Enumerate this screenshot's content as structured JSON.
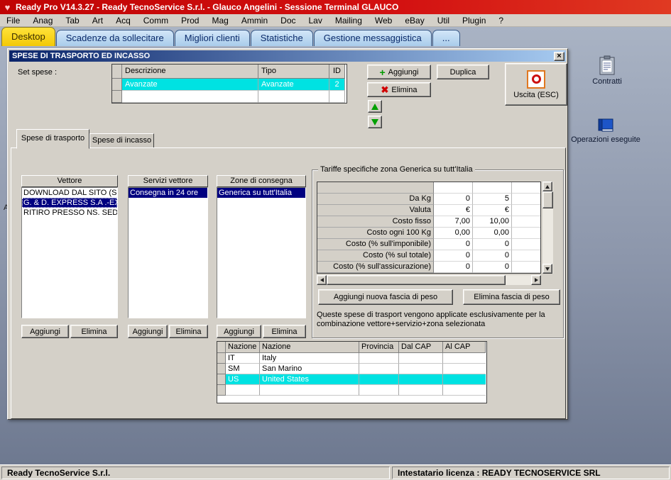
{
  "window": {
    "title": "Ready Pro V14.3.27 - Ready TecnoService S.r.l. - Glauco Angelini - Sessione Terminal GLAUCO"
  },
  "menu": {
    "items": [
      "File",
      "Anag",
      "Tab",
      "Art",
      "Acq",
      "Comm",
      "Prod",
      "Mag",
      "Ammin",
      "Doc",
      "Lav",
      "Mailing",
      "Web",
      "eBay",
      "Util",
      "Plugin",
      "?"
    ]
  },
  "main_tabs": [
    {
      "label": "Desktop"
    },
    {
      "label": "Scadenze da sollecitare"
    },
    {
      "label": "Migliori clienti"
    },
    {
      "label": "Statistiche"
    },
    {
      "label": "Gestione messaggistica"
    },
    {
      "label": "..."
    }
  ],
  "dialog": {
    "title": "SPESE DI TRASPORTO ED INCASSO",
    "close_glyph": "×",
    "set_spese_label": "Set spese :",
    "set_grid": {
      "headers": [
        "Descrizione",
        "Tipo",
        "ID"
      ],
      "row": {
        "descrizione": "Avanzate",
        "tipo": "Avanzate",
        "id": "2"
      }
    },
    "toolbar": {
      "aggiungi": "Aggiungi",
      "duplica": "Duplica",
      "elimina": "Elimina",
      "uscita": "Uscita (ESC)"
    },
    "subtabs": [
      {
        "label": "Spese di trasporto"
      },
      {
        "label": "Spese di incasso"
      }
    ],
    "vettore": {
      "title": "Vettore",
      "items": [
        "DOWNLOAD DAL SITO (SO",
        "G. & D. EXPRESS S.A .-EX",
        "RITIRO PRESSO NS. SEDE"
      ],
      "aggiungi": "Aggiungi",
      "elimina": "Elimina"
    },
    "servizi": {
      "title": "Servizi vettore",
      "items": [
        "Consegna in 24 ore"
      ],
      "aggiungi": "Aggiungi",
      "elimina": "Elimina"
    },
    "zone": {
      "title": "Zone di consegna",
      "items": [
        "Generica su tutt'Italia"
      ],
      "aggiungi": "Aggiungi",
      "elimina": "Elimina"
    },
    "tariffe": {
      "title": "Tariffe specifiche zona Generica su tutt'Italia",
      "rows": [
        {
          "label": "Da Kg",
          "v1": "0",
          "v2": "5"
        },
        {
          "label": "Valuta",
          "v1": "€",
          "v2": "€"
        },
        {
          "label": "Costo fisso",
          "v1": "7,00",
          "v2": "10,00"
        },
        {
          "label": "Costo ogni 100 Kg",
          "v1": "0,00",
          "v2": "0,00"
        },
        {
          "label": "Costo (% sull'imponibile)",
          "v1": "0",
          "v2": "0"
        },
        {
          "label": "Costo (% sul totale)",
          "v1": "0",
          "v2": "0"
        },
        {
          "label": "Costo (% sull'assicurazione)",
          "v1": "0",
          "v2": "0"
        }
      ],
      "add_button": "Aggiungi nuova fascia di peso",
      "del_button": "Elimina fascia di peso",
      "note_line1": "Queste spese di trasport vengono applicate esclusivamente per la",
      "note_line2": "combinazione vettore+servizio+zona selezionata"
    },
    "nazioni": {
      "headers": [
        "Nazione",
        "Nazione",
        "Provincia",
        "Dal CAP",
        "Al CAP"
      ],
      "rows": [
        {
          "code": "IT",
          "name": "Italy"
        },
        {
          "code": "SM",
          "name": "San Marino"
        },
        {
          "code": "US",
          "name": "United States"
        },
        {
          "code": "",
          "name": ""
        }
      ]
    }
  },
  "desktop_icons": [
    {
      "label": "Contratti"
    },
    {
      "label": "Operazioni eseguite"
    }
  ],
  "stray_label": "A",
  "statusbar": {
    "left": "Ready TecnoService S.r.l.",
    "right": "Intestatario licenza : READY TECNOSERVICE SRL"
  }
}
